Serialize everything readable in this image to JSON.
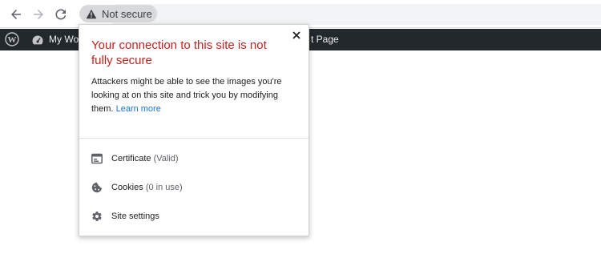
{
  "browser": {
    "security_chip": {
      "label": "Not secure",
      "icon": "warning-icon"
    },
    "nav": {
      "back_icon": "back-arrow-icon",
      "forward_icon": "forward-arrow-icon",
      "reload_icon": "reload-icon"
    }
  },
  "wp_admin_bar": {
    "logo_icon": "wordpress-logo-icon",
    "site_icon": "dashboard-icon",
    "site_name": "My Wo",
    "partial_item": "t Page",
    "background": "#23282d"
  },
  "popup": {
    "title": "Your connection to this site is not fully secure",
    "description": "Attackers might be able to see the images you're looking at on this site and trick you by modifying them.",
    "learn_more": "Learn more",
    "close_icon": "close-icon",
    "items": [
      {
        "icon": "certificate-icon",
        "label": "Certificate",
        "detail": "(Valid)"
      },
      {
        "icon": "cookie-icon",
        "label": "Cookies",
        "detail": "(0 in use)"
      },
      {
        "icon": "gear-icon",
        "label": "Site settings",
        "detail": ""
      }
    ],
    "title_color": "#c5221f",
    "link_color": "#1a73e8"
  }
}
